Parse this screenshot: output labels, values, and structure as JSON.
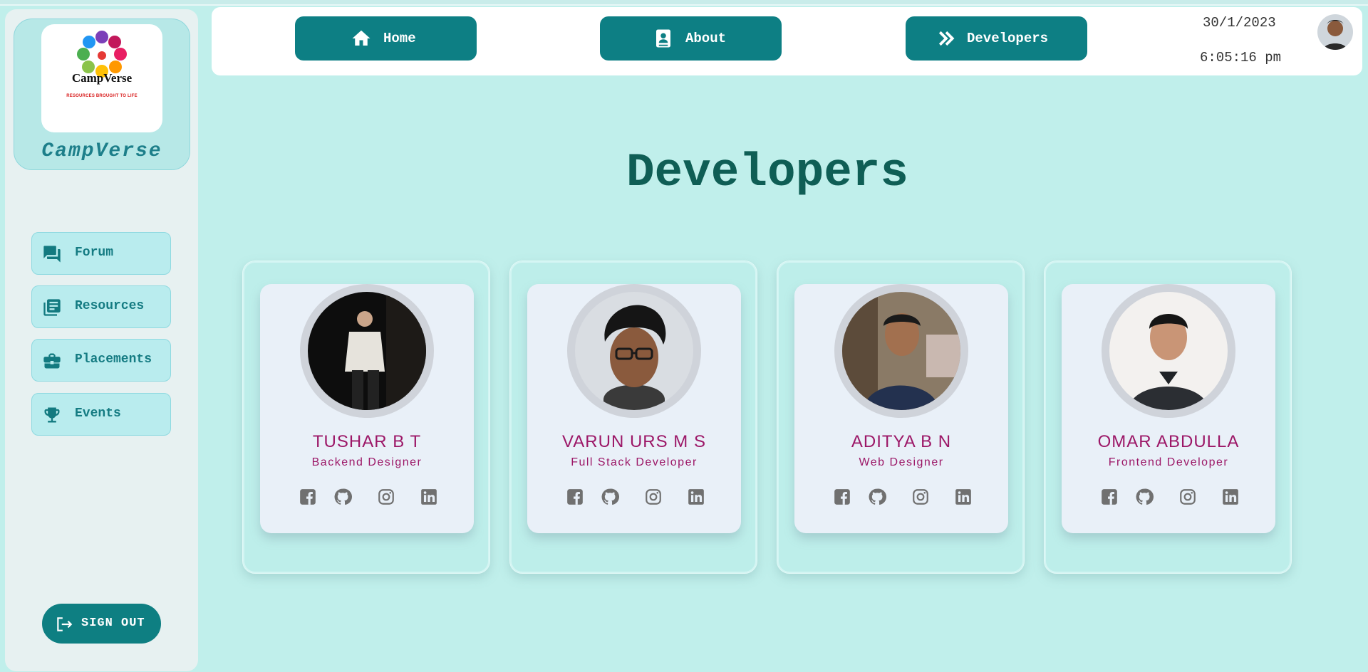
{
  "sidebar": {
    "logo_word": "CampVerse",
    "logo_tagline": "RESOURCES BROUGHT TO LIFE",
    "brand_name": "CampVerse",
    "items": [
      {
        "label": "Forum",
        "icon": "forum-icon"
      },
      {
        "label": "Resources",
        "icon": "library-books-icon"
      },
      {
        "label": "Placements",
        "icon": "briefcase-icon"
      },
      {
        "label": "Events",
        "icon": "trophy-icon"
      }
    ],
    "signout_label": "SIGN OUT"
  },
  "topbar": {
    "buttons": [
      {
        "label": "Home",
        "icon": "home-icon"
      },
      {
        "label": "About",
        "icon": "contact-card-icon"
      },
      {
        "label": "Developers",
        "icon": "double-chevron-right-icon"
      }
    ],
    "date": "30/1/2023",
    "time": "6:05:16 pm"
  },
  "main": {
    "title": "Developers",
    "developers": [
      {
        "name": "TUSHAR B T",
        "role": "Backend Designer"
      },
      {
        "name": "VARUN URS M S",
        "role": "Full Stack Developer"
      },
      {
        "name": "ADITYA B N",
        "role": "Web Designer"
      },
      {
        "name": "OMAR ABDULLA",
        "role": "Frontend Developer"
      }
    ],
    "social_icons": [
      "facebook-icon",
      "github-icon",
      "instagram-icon",
      "linkedin-icon"
    ]
  },
  "colors": {
    "background": "#c0efeb",
    "accent": "#0d7f84",
    "title": "#0f5e55",
    "dev_text": "#9c1767"
  }
}
